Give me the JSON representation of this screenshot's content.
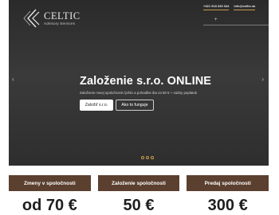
{
  "header": {
    "logo": {
      "name": "CELTIC",
      "tagline": "Advisory Services"
    },
    "phone": "+421 918 349 344",
    "email": "info@celtic.sk",
    "lang_symbol": "+"
  },
  "hero": {
    "title": "Založenie s.r.o. ONLINE",
    "subtitle": "Založenie novej spoločnosti rýchlo a pohodlne iba za 50 € + súdny poplatok",
    "primary_button": "Založiť s.r.o.",
    "secondary_button": "Ako to funguje",
    "prev_arrow": "‹",
    "next_arrow": "›",
    "slides": 3
  },
  "services": [
    {
      "title": "Zmeny v spoločnosti",
      "price": "od 70 €"
    },
    {
      "title": "Založenie spoločnosti",
      "price": "50 €"
    },
    {
      "title": "Predaj spoločnosti",
      "price": "300 €"
    }
  ],
  "colors": {
    "accent": "#c79a4a",
    "card_header": "#5b3f2f",
    "hero_bg": "#333333"
  }
}
